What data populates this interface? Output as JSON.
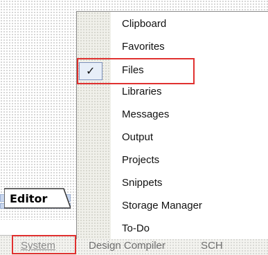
{
  "editor_tab": {
    "label": "Editor"
  },
  "panels_bar": {
    "items": [
      {
        "label": "System"
      },
      {
        "label": "Design Compiler"
      },
      {
        "label": "SCH"
      }
    ]
  },
  "menu": {
    "items": [
      {
        "label": "Clipboard",
        "checked": false
      },
      {
        "label": "Favorites",
        "checked": false
      },
      {
        "label": "Files",
        "checked": true
      },
      {
        "label": "Libraries",
        "checked": false
      },
      {
        "label": "Messages",
        "checked": false
      },
      {
        "label": "Output",
        "checked": false
      },
      {
        "label": "Projects",
        "checked": false
      },
      {
        "label": "Snippets",
        "checked": false
      },
      {
        "label": "Storage Manager",
        "checked": false
      },
      {
        "label": "To-Do",
        "checked": false
      }
    ],
    "check_glyph": "✓"
  },
  "colors": {
    "highlight": "#e0302f",
    "check_bg": "#e7eef8"
  }
}
